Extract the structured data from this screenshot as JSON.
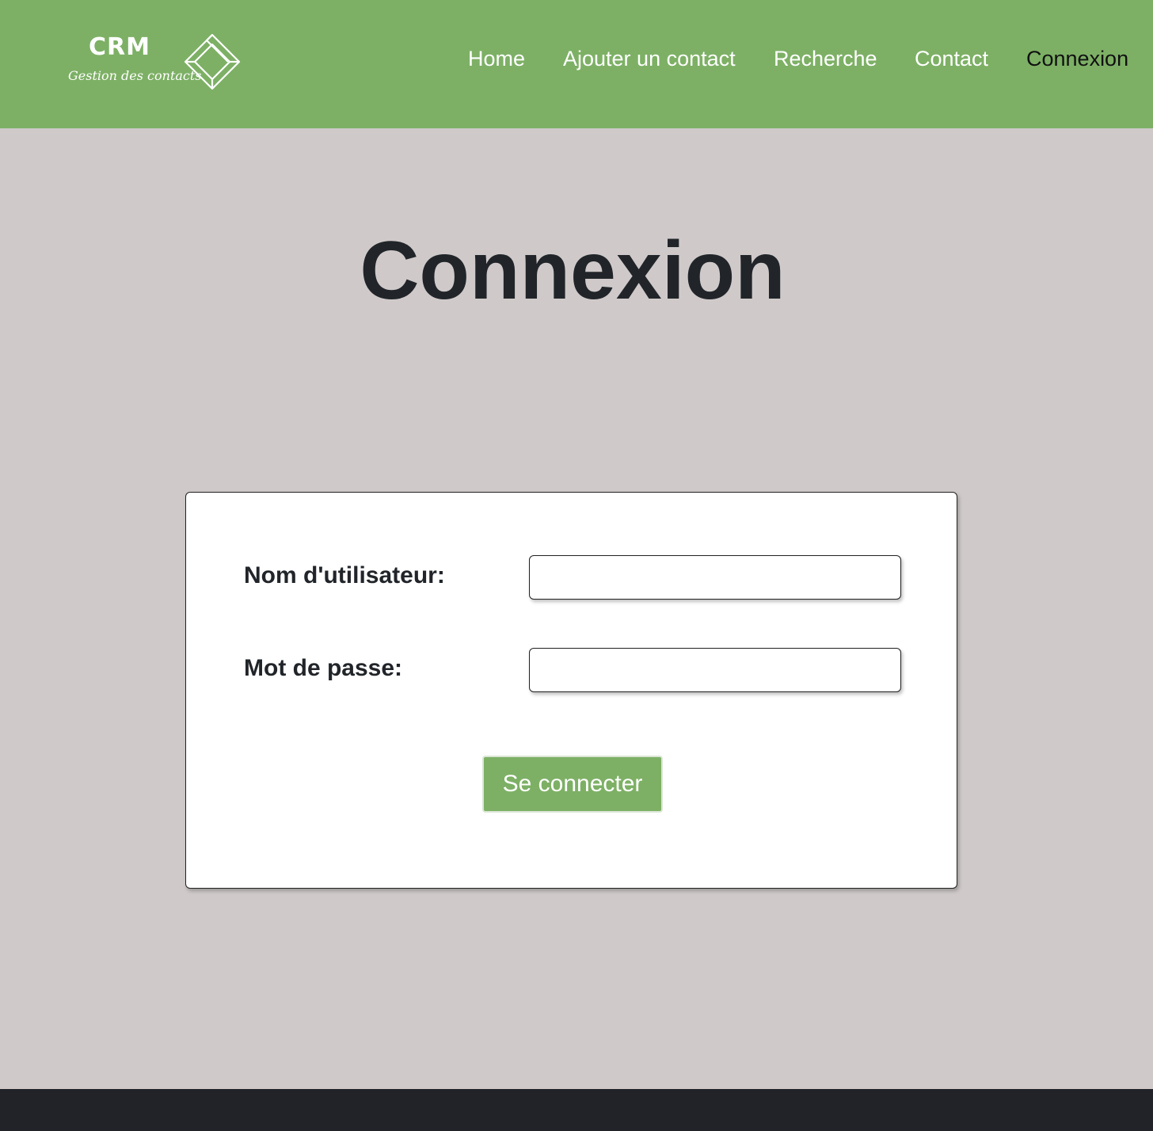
{
  "header": {
    "logo": {
      "title": "CRM",
      "subtitle": "Gestion des contacts",
      "mark_icon": "isometric-square-outline-icon"
    },
    "nav": [
      {
        "label": "Home",
        "active": false
      },
      {
        "label": "Ajouter un contact",
        "active": false
      },
      {
        "label": "Recherche",
        "active": false
      },
      {
        "label": "Contact",
        "active": false
      },
      {
        "label": "Connexion",
        "active": true
      }
    ]
  },
  "main": {
    "title": "Connexion",
    "form": {
      "username_label": "Nom d'utilisateur:",
      "username_value": "",
      "password_label": "Mot de passe:",
      "password_value": "",
      "submit_label": "Se connecter"
    }
  },
  "colors": {
    "brand_green": "#7db065",
    "page_background": "#cfc9c9",
    "footer_dark": "#212328",
    "text_dark": "#212529"
  }
}
